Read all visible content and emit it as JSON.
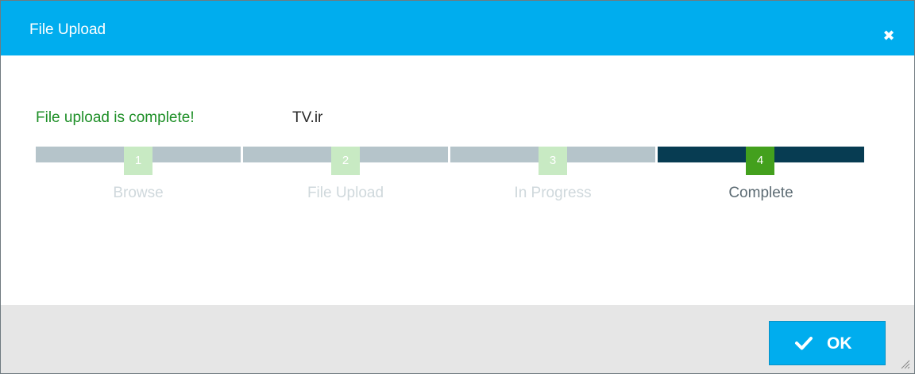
{
  "dialog": {
    "title": "File Upload",
    "close_icon": "close-icon"
  },
  "message": {
    "text": "File upload is complete!",
    "filename": "TV.ir"
  },
  "steps": [
    {
      "number": "1",
      "label": "Browse",
      "state": "done"
    },
    {
      "number": "2",
      "label": "File Upload",
      "state": "done"
    },
    {
      "number": "3",
      "label": "In Progress",
      "state": "done"
    },
    {
      "number": "4",
      "label": "Complete",
      "state": "active"
    }
  ],
  "footer": {
    "ok_label": "OK",
    "ok_icon": "check-icon"
  },
  "colors": {
    "header": "#00adee",
    "success_text": "#1e8f27",
    "active_step": "#43a01d",
    "active_bar": "#073c52",
    "inactive_bar": "#b5c4ca"
  }
}
